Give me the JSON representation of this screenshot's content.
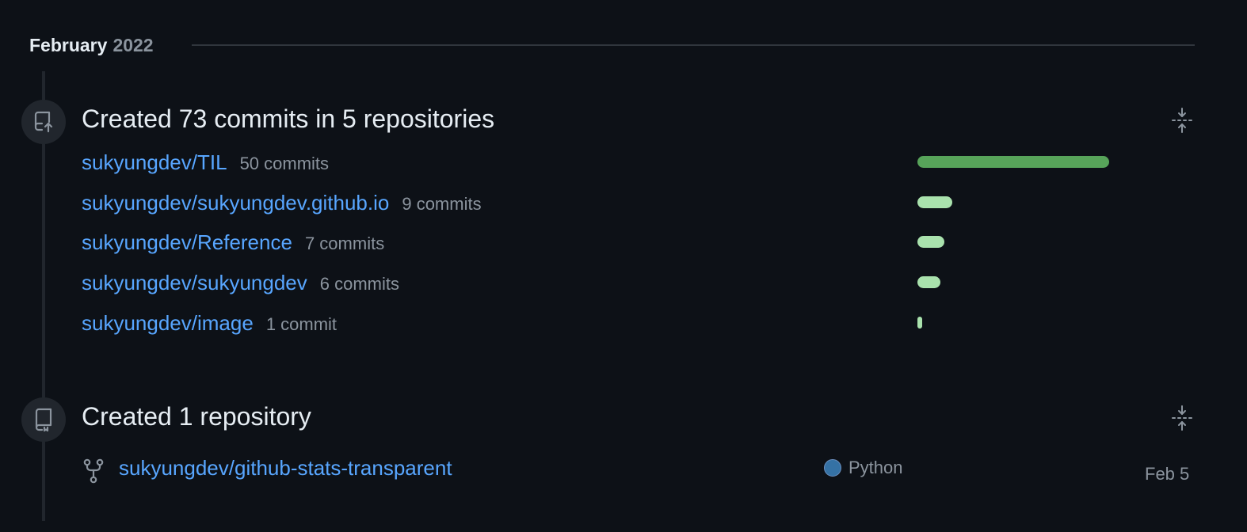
{
  "month_header": {
    "month": "February",
    "year": "2022"
  },
  "commits_event": {
    "title": "Created 73 commits in 5 repositories",
    "icon": "repo-push-icon",
    "fold_icon": "fold-icon",
    "repos": [
      {
        "name": "sukyungdev/TIL",
        "commits_label": "50 commits",
        "commits": 50
      },
      {
        "name": "sukyungdev/sukyungdev.github.io",
        "commits_label": "9 commits",
        "commits": 9
      },
      {
        "name": "sukyungdev/Reference",
        "commits_label": "7 commits",
        "commits": 7
      },
      {
        "name": "sukyungdev/sukyungdev",
        "commits_label": "6 commits",
        "commits": 6
      },
      {
        "name": "sukyungdev/image",
        "commits_label": "1 commit",
        "commits": 1
      }
    ],
    "bar_colors": {
      "max": "#57a45a",
      "other": "#a9e2ad"
    }
  },
  "repo_event": {
    "title": "Created 1 repository",
    "icon": "repo-icon",
    "fold_icon": "fold-icon",
    "repo": {
      "icon": "repo-forked-icon",
      "name": "sukyungdev/github-stats-transparent",
      "language": "Python",
      "language_color": "#3572A5",
      "date": "Feb 5"
    }
  }
}
